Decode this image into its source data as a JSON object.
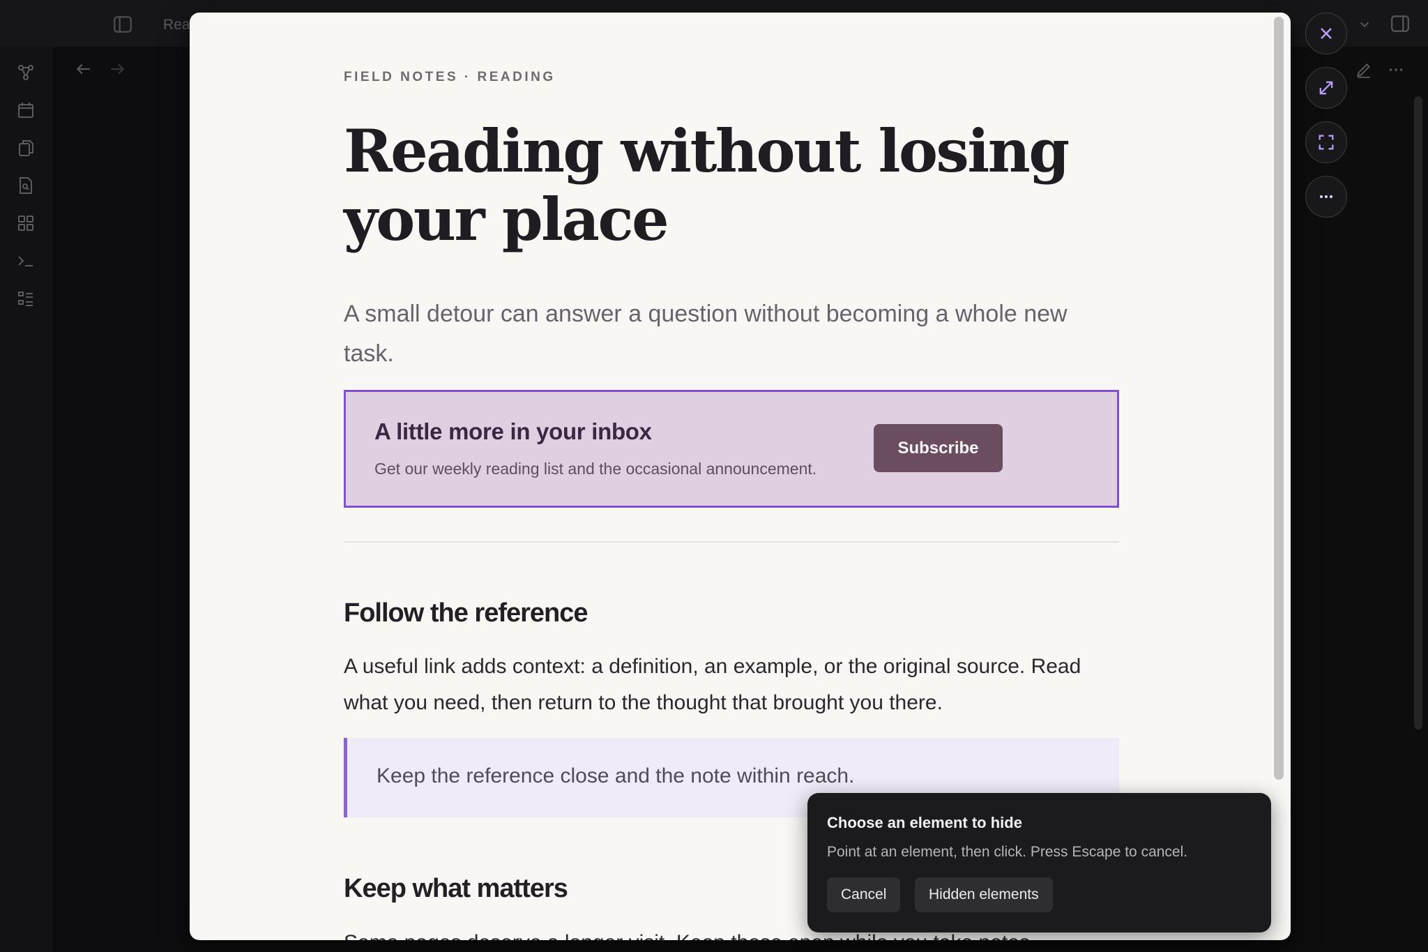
{
  "app": {
    "tab_label": "Rea",
    "ribbon_icons": [
      "graph-icon",
      "calendar-icon",
      "copy-icon",
      "file-search-icon",
      "grid-icon",
      "terminal-icon",
      "list-icon"
    ]
  },
  "reader": {
    "eyebrow": "FIELD NOTES · READING",
    "title": "Reading without losing your place",
    "subtitle": "A small detour can answer a question without becoming a whole new task.",
    "promo": {
      "title": "A little more in your inbox",
      "text": "Get our weekly reading list and the occasional announcement.",
      "button_label": "Subscribe"
    },
    "section1": {
      "heading": "Follow the reference",
      "paragraph": "A useful link adds context: a definition, an example, or the original source. Read what you need, then return to the thought that brought you there.",
      "quote": "Keep the reference close and the note within reach."
    },
    "section2": {
      "heading": "Keep what matters",
      "paragraph": "Some pages deserve a longer visit. Keep those open while you take notes,"
    }
  },
  "side_controls": [
    "close-icon",
    "expand-icon",
    "fullscreen-icon",
    "more-icon"
  ],
  "popover": {
    "title": "Choose an element to hide",
    "text": "Point at an element, then click. Press Escape to cancel.",
    "cancel_label": "Cancel",
    "hidden_label": "Hidden elements"
  },
  "colors": {
    "accent": "#8050d0",
    "promo_bg": "#e0cfe0",
    "subscribe_bg": "#6a4e60",
    "reader_bg": "#f9f7f4"
  }
}
